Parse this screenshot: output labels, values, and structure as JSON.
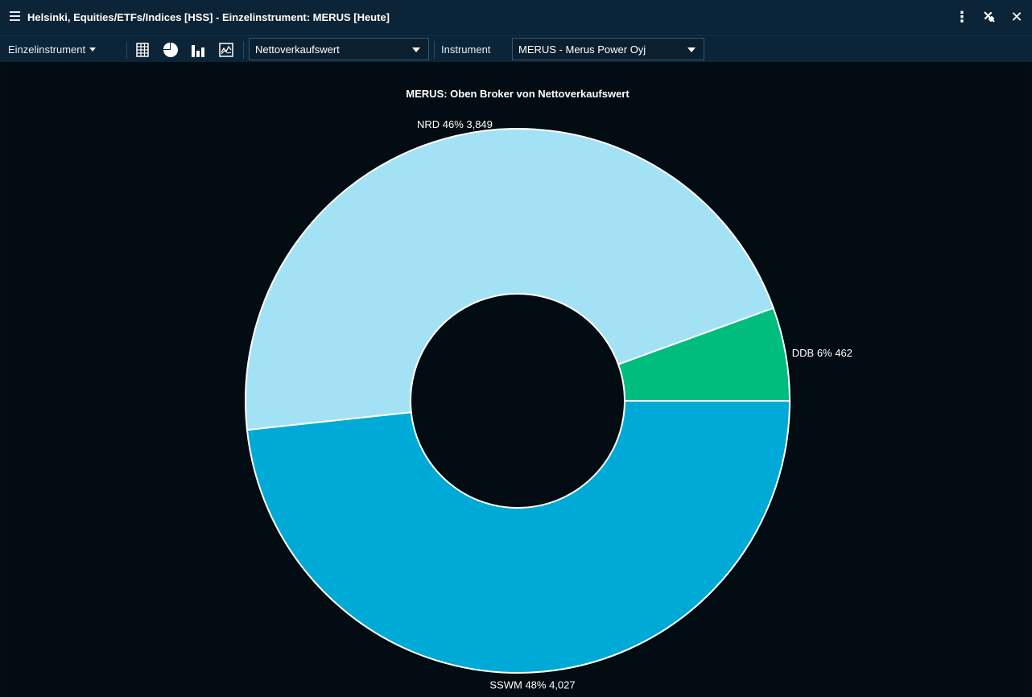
{
  "window": {
    "title": "Helsinki, Equities/ETFs/Indices [HSS] - Einzelinstrument: MERUS [Heute]"
  },
  "title_actions": {
    "more_icon": "vertical-ellipsis-icon",
    "unlink_icon": "unlink-icon",
    "close_icon": "close-icon",
    "more_glyph": "⋮",
    "close_glyph": "✕"
  },
  "toolbar": {
    "mode_label": "Einzelinstrument",
    "view_icons": [
      "table-icon",
      "pie-chart-icon",
      "bar-chart-icon",
      "line-chart-icon"
    ],
    "measure_select_value": "Nettoverkaufswert",
    "instrument_label": "Instrument",
    "instrument_select_value": "MERUS - Merus Power Oyj"
  },
  "colors": {
    "title_bar_bg": "#0b2437",
    "chart_bg": "#030c12",
    "nrd": "#a3e1f5",
    "ddb": "#00bd7d",
    "sswm": "#00aad6"
  },
  "chart_data": {
    "type": "pie",
    "subtype": "donut",
    "title": "MERUS: Oben Broker von Nettoverkaufswert",
    "slices": [
      {
        "name": "DDB",
        "value": 462,
        "percent_label": "6%",
        "value_label": "462",
        "color": "#00bd7d"
      },
      {
        "name": "SSWM",
        "value": 4027,
        "percent_label": "48%",
        "value_label": "4,027",
        "color": "#00aad6"
      },
      {
        "name": "NRD",
        "value": 3849,
        "percent_label": "46%",
        "value_label": "3,849",
        "color": "#a3e1f5"
      }
    ]
  }
}
